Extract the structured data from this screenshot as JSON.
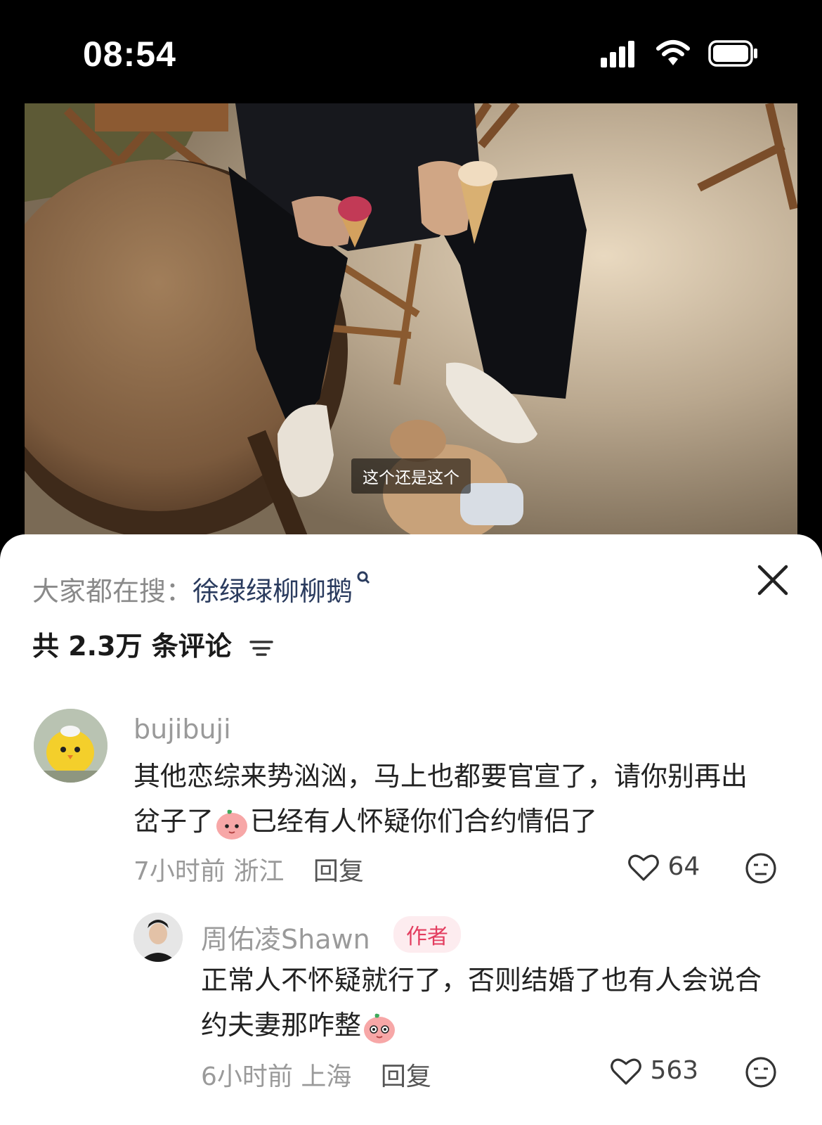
{
  "status": {
    "time": "08:54"
  },
  "video": {
    "subtitle": "这个还是这个"
  },
  "panel": {
    "search_prefix": "大家都在搜：",
    "search_term": "徐绿绿柳柳鹅",
    "comment_count": "共 2.3万 条评论"
  },
  "comments": [
    {
      "user": "bujibuji",
      "text_part1": "其他恋综来势汹汹，马上也都要官宣了，请你别再出岔子了",
      "text_part2": "已经有人怀疑你们合约情侣了",
      "time": "7小时前",
      "location": "浙江",
      "reply_label": "回复",
      "likes": "64"
    },
    {
      "user": "周佑凌Shawn",
      "badge": "作者",
      "text_part1": "正常人不怀疑就行了，否则结婚了也有人会说合约夫妻那咋整",
      "time": "6小时前",
      "location": "上海",
      "reply_label": "回复",
      "likes": "563"
    }
  ],
  "icons": {
    "close": "close-icon",
    "sort": "filter-lines-icon",
    "like": "heart-outline-icon",
    "dislike": "meh-face-icon",
    "emoji": "peach-face-emoji"
  }
}
